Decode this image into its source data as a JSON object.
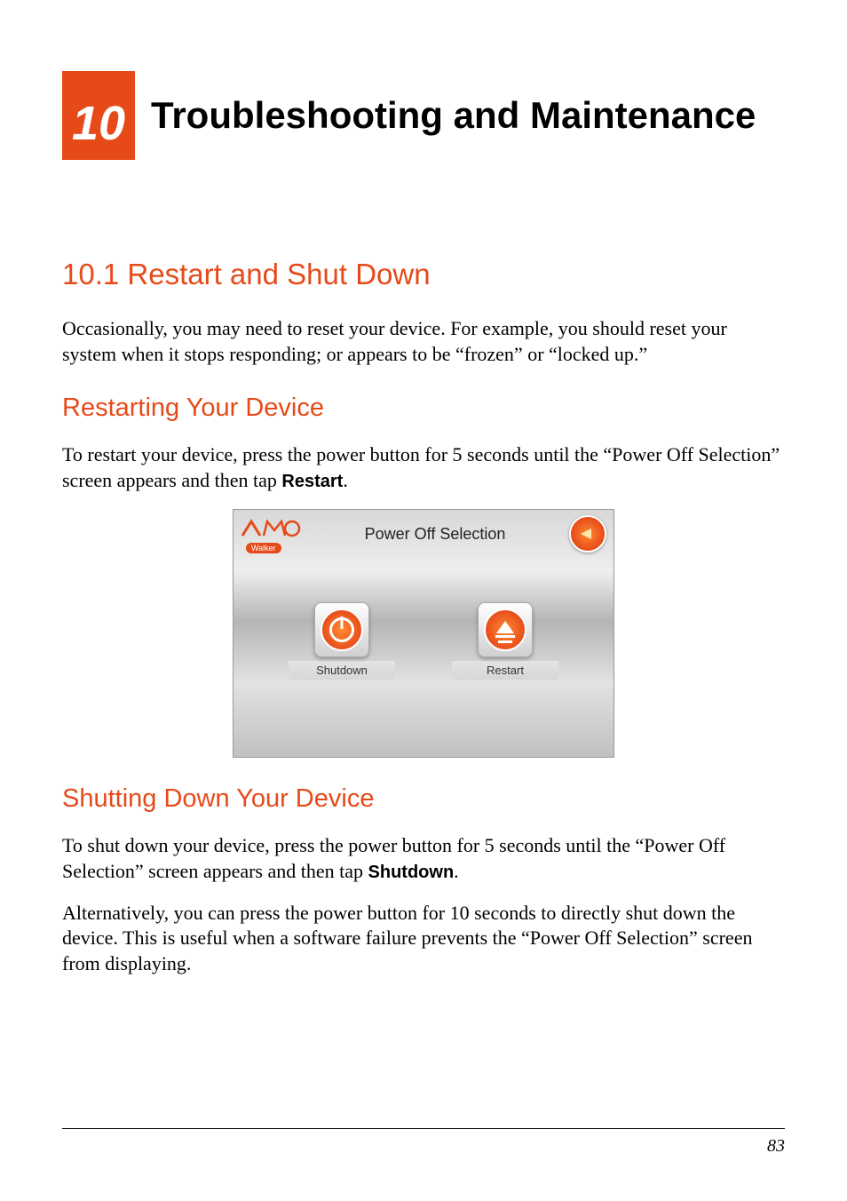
{
  "chapter": {
    "number": "10",
    "title": "Troubleshooting and Maintenance"
  },
  "section": {
    "heading": "10.1  Restart and Shut Down",
    "intro": "Occasionally, you may need to reset your device. For example, you should reset your system when it stops responding; or appears to be “frozen” or “locked up.”"
  },
  "restart": {
    "heading": "Restarting Your Device",
    "text_before": "To restart your device, press the power button for 5 seconds until the “Power Off Selection” screen appears and then tap ",
    "bold": "Restart",
    "text_after": "."
  },
  "device_screenshot": {
    "logo_brand": "mio",
    "logo_sub": "Walker",
    "title": "Power Off Selection",
    "shutdown_label": "Shutdown",
    "restart_label": "Restart"
  },
  "shutdown": {
    "heading": "Shutting Down Your Device",
    "p1_before": "To shut down your device, press the power button for 5 seconds until the “Power Off Selection” screen appears and then tap ",
    "p1_bold": "Shutdown",
    "p1_after": ".",
    "p2": "Alternatively, you can press the power button for 10 seconds to directly shut down the device. This is useful when a software failure prevents the “Power Off Selection” screen from displaying."
  },
  "page_number": "83"
}
